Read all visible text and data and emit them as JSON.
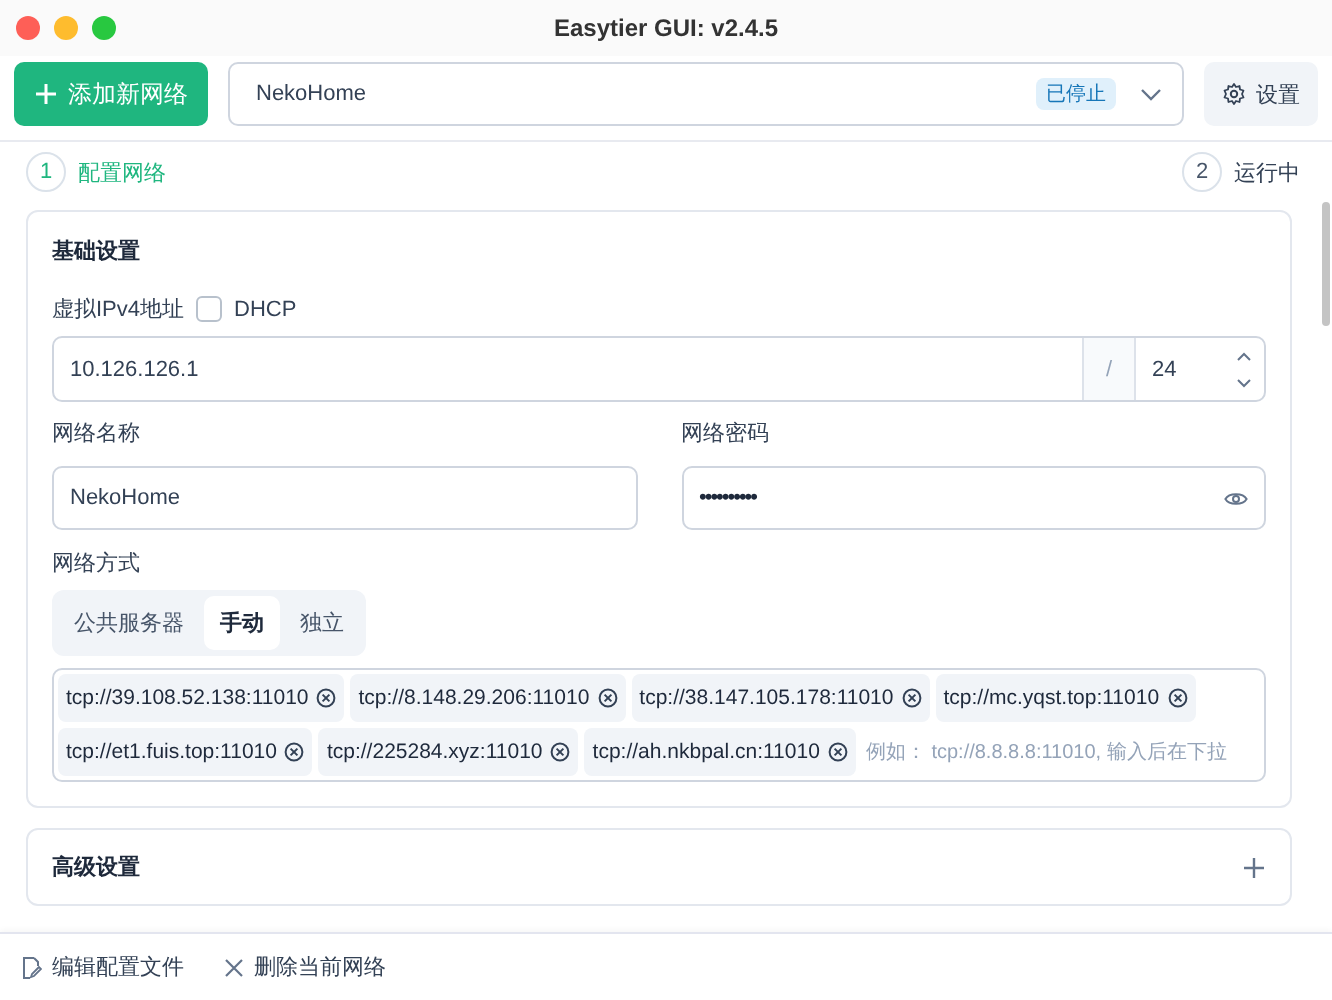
{
  "window": {
    "title": "Easytier GUI: v2.4.5"
  },
  "toolbar": {
    "add_button": "添加新网络",
    "network_select": {
      "value": "NekoHome",
      "status": "已停止"
    },
    "settings_button": "设置"
  },
  "steps": [
    {
      "number": "1",
      "label": "配置网络",
      "selected": true
    },
    {
      "number": "2",
      "label": "运行中",
      "selected": false
    }
  ],
  "basic_settings": {
    "title": "基础设置",
    "ipv4": {
      "label": "虚拟IPv4地址",
      "dhcp": {
        "label": "DHCP",
        "checked": false
      },
      "address": "10.126.126.1",
      "separator": "/",
      "prefix": "24"
    },
    "network_name": {
      "label": "网络名称",
      "value": "NekoHome"
    },
    "network_secret": {
      "label": "网络密码",
      "value": "••••••••••"
    },
    "network_mode": {
      "label": "网络方式",
      "options": [
        {
          "label": "公共服务器",
          "selected": false
        },
        {
          "label": "手动",
          "selected": true
        },
        {
          "label": "独立",
          "selected": false
        }
      ]
    },
    "peers": {
      "items": [
        "tcp://39.108.52.138:11010",
        "tcp://8.148.29.206:11010",
        "tcp://38.147.105.178:11010",
        "tcp://mc.yqst.top:11010",
        "tcp://et1.fuis.top:11010",
        "tcp://225284.xyz:11010",
        "tcp://ah.nkbpal.cn:11010"
      ],
      "placeholder": "例如： tcp://8.8.8.8:11010, 输入后在下拉"
    }
  },
  "advanced_settings": {
    "title": "高级设置",
    "expanded": false
  },
  "bottom_bar": {
    "actions": [
      {
        "kind": "edit",
        "label": "编辑配置文件"
      },
      {
        "kind": "delete",
        "label": "删除当前网络"
      }
    ]
  }
}
